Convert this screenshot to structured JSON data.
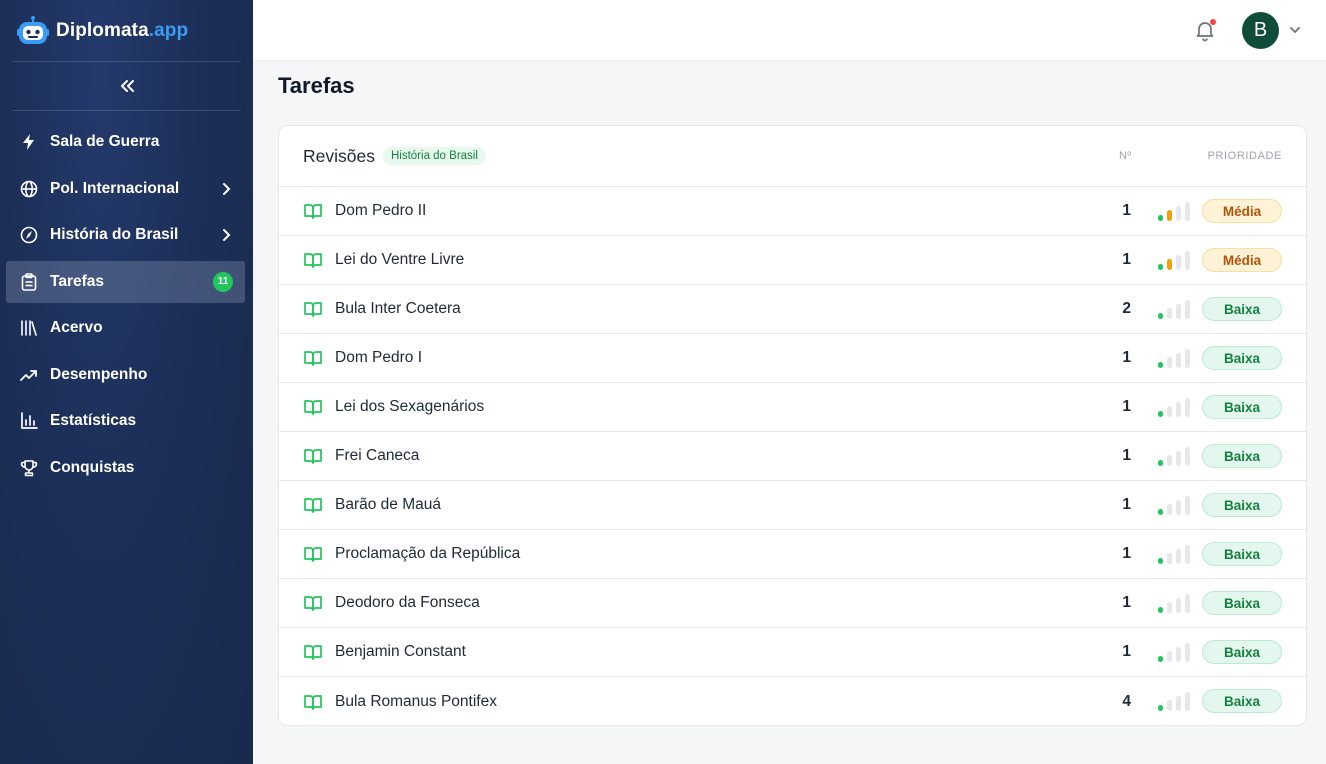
{
  "brand": {
    "name": "Diplomata",
    "suffix": ".app"
  },
  "sidebar": {
    "items": [
      {
        "label": "Sala de Guerra",
        "icon": "bolt-icon"
      },
      {
        "label": "Pol. Internacional",
        "icon": "globe-icon"
      },
      {
        "label": "História do Brasil",
        "icon": "compass-icon"
      },
      {
        "label": "Tarefas",
        "icon": "clipboard-icon",
        "badge": "11"
      },
      {
        "label": "Acervo",
        "icon": "library-icon"
      },
      {
        "label": "Desempenho",
        "icon": "trending-up-icon"
      },
      {
        "label": "Estatísticas",
        "icon": "bar-chart-icon"
      },
      {
        "label": "Conquistas",
        "icon": "trophy-icon"
      }
    ]
  },
  "topbar": {
    "avatar_initial": "B"
  },
  "page": {
    "title": "Tarefas"
  },
  "card": {
    "title": "Revisões",
    "tag": "História do Brasil",
    "col_number": "Nº",
    "col_priority": "PRIORIDADE",
    "rows": [
      {
        "name": "Dom Pedro II",
        "count": "1",
        "priority": "Média",
        "level": 2
      },
      {
        "name": "Lei do Ventre Livre",
        "count": "1",
        "priority": "Média",
        "level": 2
      },
      {
        "name": "Bula Inter Coetera",
        "count": "2",
        "priority": "Baixa",
        "level": 1
      },
      {
        "name": "Dom Pedro I",
        "count": "1",
        "priority": "Baixa",
        "level": 1
      },
      {
        "name": "Lei dos Sexagenários",
        "count": "1",
        "priority": "Baixa",
        "level": 1
      },
      {
        "name": "Frei Caneca",
        "count": "1",
        "priority": "Baixa",
        "level": 1
      },
      {
        "name": "Barão de Mauá",
        "count": "1",
        "priority": "Baixa",
        "level": 1
      },
      {
        "name": "Proclamação da República",
        "count": "1",
        "priority": "Baixa",
        "level": 1
      },
      {
        "name": "Deodoro da Fonseca",
        "count": "1",
        "priority": "Baixa",
        "level": 1
      },
      {
        "name": "Benjamin Constant",
        "count": "1",
        "priority": "Baixa",
        "level": 1
      },
      {
        "name": "Bula Romanus Pontifex",
        "count": "4",
        "priority": "Baixa",
        "level": 1
      }
    ]
  },
  "colors": {
    "sidebar_bg": "#1c2f58",
    "accent_green": "#22c55e",
    "accent_orange": "#f59e0b",
    "brand_blue": "#3b9cf5"
  }
}
